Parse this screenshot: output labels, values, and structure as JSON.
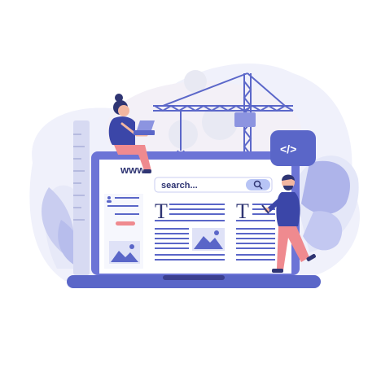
{
  "illustration": {
    "url_text": "www.",
    "search": {
      "placeholder": "search..."
    },
    "code_badge": "</>",
    "article_initials": [
      "T",
      "T"
    ],
    "icons": {
      "search": "magnifier-icon",
      "code": "code-brackets-icon",
      "image": "mountain-image-icon",
      "user": "user-icon"
    },
    "colors": {
      "primary": "#5a66c8",
      "primary_dark": "#3b3f8f",
      "accent": "#ef8a8f",
      "background_blob": "#eef0fb",
      "screen": "#ffffff",
      "laptop_frame": "#6c74d6",
      "skin": "#f2b6a0",
      "crane": "#5b67c9"
    }
  }
}
